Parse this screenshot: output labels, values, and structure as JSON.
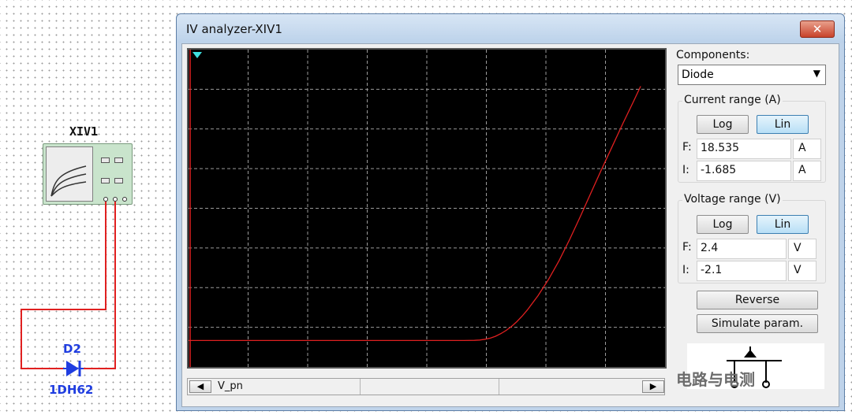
{
  "schematic": {
    "instrument_label": "XIV1",
    "diode_ref": "D2",
    "diode_model": "1DH62"
  },
  "window": {
    "title": "IV analyzer-XIV1",
    "close_glyph": "✕"
  },
  "panel": {
    "components_label": "Components:",
    "component_selected": "Diode",
    "current_range": {
      "label": "Current range (A)",
      "log_label": "Log",
      "lin_label": "Lin",
      "selected": "Lin",
      "final_prefix": "F:",
      "final_value": "18.535",
      "final_unit": "A",
      "initial_prefix": "I:",
      "initial_value": "-1.685",
      "initial_unit": "A"
    },
    "voltage_range": {
      "label": "Voltage range (V)",
      "log_label": "Log",
      "lin_label": "Lin",
      "selected": "Lin",
      "final_prefix": "F:",
      "final_value": "2.4",
      "final_unit": "V",
      "initial_prefix": "I:",
      "initial_value": "-2.1",
      "initial_unit": "V"
    },
    "reverse_label": "Reverse",
    "simulate_label": "Simulate param."
  },
  "bottom_bar": {
    "left_arrow": "◀",
    "readout": "V_pn",
    "right_arrow": "▶"
  },
  "logo": {
    "watermark_text": "电路与电测"
  },
  "colors": {
    "plot_background": "#000000",
    "grid": "#9a9a9a",
    "curve": "#e02020",
    "axis": "#e02020"
  },
  "chart_data": {
    "type": "line",
    "title": "",
    "xlabel": "",
    "ylabel": "",
    "xlim": [
      -2.1,
      2.4
    ],
    "ylim": [
      -1.685,
      18.535
    ],
    "grid": true,
    "series": [
      {
        "x": [
          -2.1,
          -1.5,
          -0.5,
          0.0,
          0.3,
          0.5,
          0.6,
          0.65,
          0.7,
          0.75,
          0.8,
          0.85,
          0.9,
          0.95,
          1.0,
          1.05,
          1.1,
          1.2,
          1.3,
          1.4,
          1.5,
          1.6,
          1.7,
          1.8,
          1.9,
          2.0,
          2.1,
          2.17
        ],
        "y": [
          0,
          0,
          0,
          0,
          0,
          0,
          0.01,
          0.03,
          0.08,
          0.15,
          0.27,
          0.44,
          0.65,
          0.9,
          1.2,
          1.55,
          1.95,
          2.85,
          3.9,
          5.1,
          6.45,
          7.9,
          9.4,
          10.9,
          12.35,
          13.8,
          15.2,
          16.2
        ]
      }
    ]
  }
}
